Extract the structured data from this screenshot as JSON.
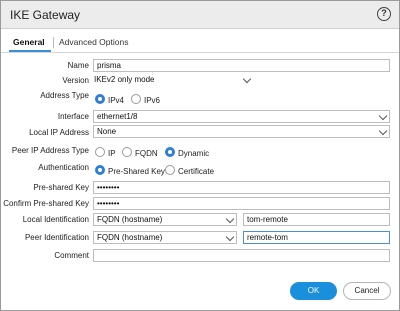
{
  "dialog": {
    "title": "IKE Gateway"
  },
  "tabs": [
    {
      "label": "General"
    },
    {
      "label": "Advanced Options"
    }
  ],
  "form": {
    "name": {
      "label": "Name",
      "value": "prisma"
    },
    "version": {
      "label": "Version",
      "value": "IKEv2 only mode"
    },
    "address_type": {
      "label": "Address Type",
      "options": [
        "IPv4",
        "IPv6"
      ],
      "selected": "IPv4"
    },
    "interface": {
      "label": "Interface",
      "value": "ethernet1/8"
    },
    "local_ip": {
      "label": "Local IP Address",
      "value": "None"
    },
    "peer_ip_type": {
      "label": "Peer IP Address Type",
      "options": [
        "IP",
        "FQDN",
        "Dynamic"
      ],
      "selected": "Dynamic"
    },
    "authentication": {
      "label": "Authentication",
      "options": [
        "Pre-Shared Key",
        "Certificate"
      ],
      "selected": "Pre-Shared Key"
    },
    "psk": {
      "label": "Pre-shared Key",
      "value": "••••••••"
    },
    "confirm_psk": {
      "label": "Confirm Pre-shared Key",
      "value": "••••••••"
    },
    "local_id": {
      "label": "Local Identification",
      "type": "FQDN (hostname)",
      "value": "tom-remote"
    },
    "peer_id": {
      "label": "Peer Identification",
      "type": "FQDN (hostname)",
      "value": "remote-tom"
    },
    "comment": {
      "label": "Comment",
      "value": ""
    }
  },
  "buttons": {
    "ok": "OK",
    "cancel": "Cancel"
  }
}
